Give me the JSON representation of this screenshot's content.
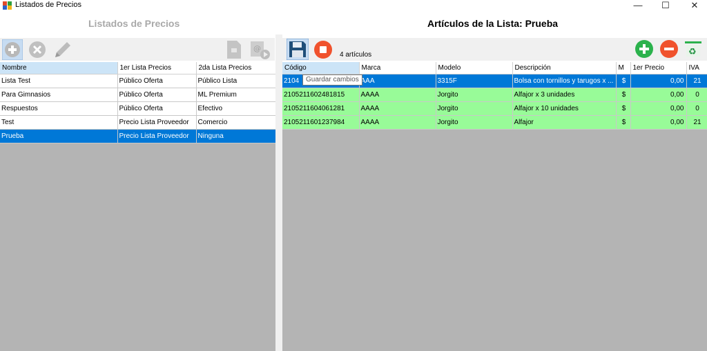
{
  "window": {
    "title": "Listados de Precios",
    "minimize": "—",
    "maximize": "☐",
    "close": "✕"
  },
  "left": {
    "header": "Listados de Precios",
    "columns": [
      "Nombre",
      "1er Lista Precios",
      "2da Lista Precios"
    ],
    "rows": [
      [
        "Lista Test",
        "Público Oferta",
        "Público Lista"
      ],
      [
        "Para Gimnasios",
        "Público Oferta",
        "ML Premium"
      ],
      [
        "Respuestos",
        "Público Oferta",
        "Efectivo"
      ],
      [
        "Test",
        "Precio Lista Proveedor",
        "Comercio"
      ],
      [
        "Prueba",
        "Precio Lista Proveedor",
        "Ninguna"
      ]
    ],
    "selected_row": 4
  },
  "right": {
    "header": "Artículos de la Lista: Prueba",
    "count": "4 artículos",
    "tooltip": "Guardar cambios",
    "columns": [
      "Código",
      "Marca",
      "Modelo",
      "Descripción",
      "M",
      "1er Precio",
      "IVA"
    ],
    "rows": [
      [
        "2104",
        "AAA",
        "3315F",
        "Bolsa con tornillos y tarugos x ...",
        "$",
        "0,00",
        "21"
      ],
      [
        "2105211602481815",
        "AAAA",
        "Jorgito",
        "Alfajor x 3 unidades",
        "$",
        "0,00",
        "0"
      ],
      [
        "2105211604061281",
        "AAAA",
        "Jorgito",
        "Alfajor x 10 unidades",
        "$",
        "0,00",
        "0"
      ],
      [
        "2105211601237984",
        "AAAA",
        "Jorgito",
        "Alfajor",
        "$",
        "0,00",
        "21"
      ]
    ],
    "selected_row": 0
  },
  "colors": {
    "selection": "#0078d7",
    "green_row": "#98fb98",
    "grid_bg": "#b4b4b4"
  },
  "icons": [
    "app-icon",
    "add-icon",
    "delete-icon",
    "edit-icon",
    "document-icon",
    "email-icon",
    "save-icon",
    "stop-icon",
    "plus-icon",
    "minus-icon",
    "recycle-icon"
  ]
}
